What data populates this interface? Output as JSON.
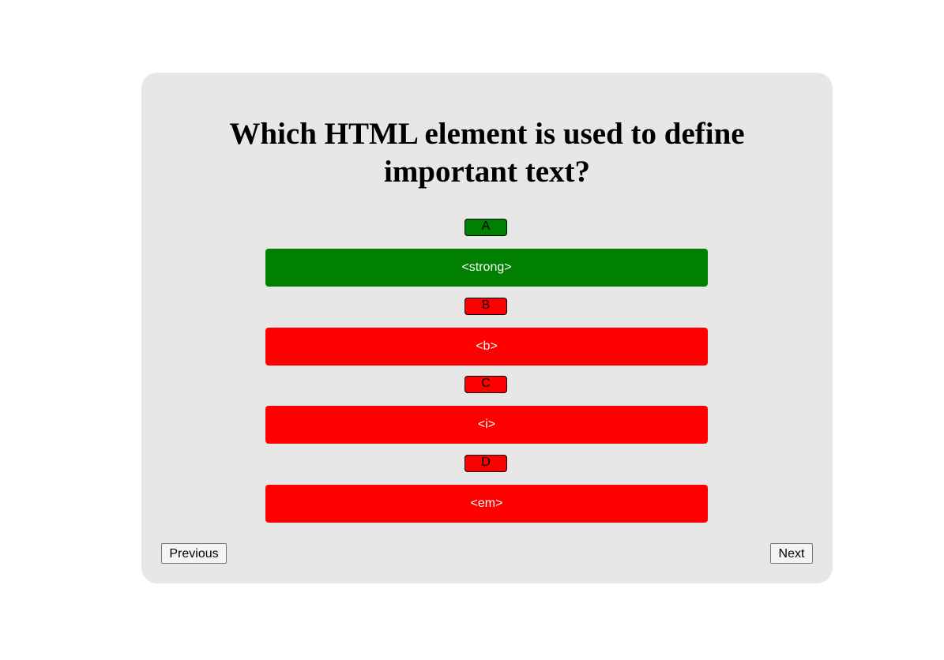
{
  "quiz": {
    "question_line1": "Which HTML element is used to define",
    "question_line2": "important text?",
    "options": [
      {
        "letter": "A",
        "text": "<strong>",
        "color": "#008000"
      },
      {
        "letter": "B",
        "text": "<b>",
        "color": "#ff0000"
      },
      {
        "letter": "C",
        "text": "<i>",
        "color": "#ff0000"
      },
      {
        "letter": "D",
        "text": "<em>",
        "color": "#ff0000"
      }
    ]
  },
  "navigation": {
    "previous_label": "Previous",
    "next_label": "Next"
  },
  "colors": {
    "card_background": "#e7e7e7",
    "correct": "#008000",
    "incorrect": "#ff0000"
  }
}
